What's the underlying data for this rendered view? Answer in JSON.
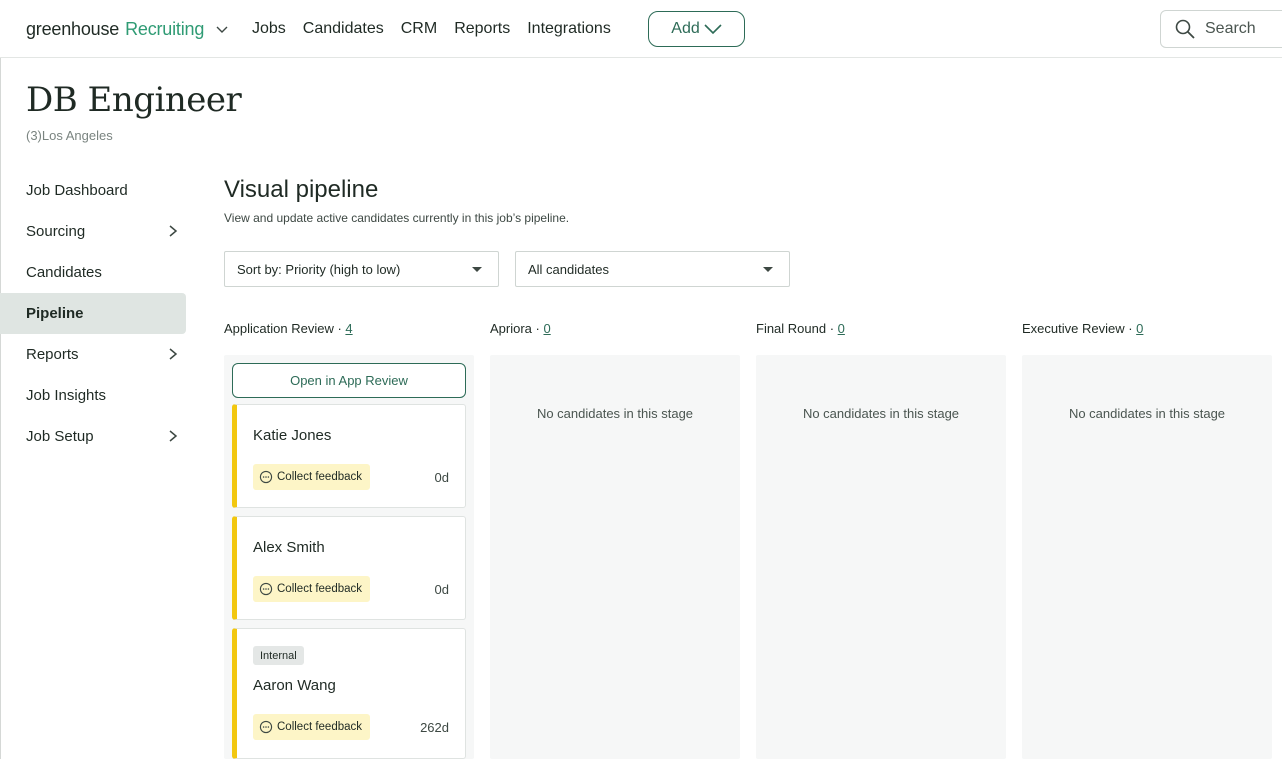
{
  "topnav": {
    "brand": "greenhouse",
    "product": "Recruiting",
    "links": [
      "Jobs",
      "Candidates",
      "CRM",
      "Reports",
      "Integrations"
    ],
    "add_label": "Add",
    "search_placeholder": "Search"
  },
  "job": {
    "title": "DB Engineer",
    "subtitle": "(3)Los Angeles"
  },
  "sidebar": {
    "items": [
      {
        "label": "Job Dashboard",
        "has_chevron": false,
        "active": false
      },
      {
        "label": "Sourcing",
        "has_chevron": true,
        "active": false
      },
      {
        "label": "Candidates",
        "has_chevron": false,
        "active": false
      },
      {
        "label": "Pipeline",
        "has_chevron": false,
        "active": true
      },
      {
        "label": "Reports",
        "has_chevron": true,
        "active": false
      },
      {
        "label": "Job Insights",
        "has_chevron": false,
        "active": false
      },
      {
        "label": "Job Setup",
        "has_chevron": true,
        "active": false
      }
    ]
  },
  "pipeline": {
    "title": "Visual pipeline",
    "description": "View and update active candidates currently in this job’s pipeline.",
    "sort_value": "Sort by: Priority (high to low)",
    "filter_value": "All candidates",
    "open_app_review": "Open in App Review",
    "empty_text": "No candidates in this stage",
    "stages": [
      {
        "name": "Application Review",
        "sep": " · ",
        "count": "4"
      },
      {
        "name": "Apriora",
        "sep": " · ",
        "count": "0"
      },
      {
        "name": "Final Round",
        "sep": " · ",
        "count": "0"
      },
      {
        "name": "Executive Review",
        "sep": " · ",
        "count": "0"
      }
    ],
    "candidates": [
      {
        "name": "Katie Jones",
        "badge": "Collect feedback",
        "days": "0d",
        "tag": ""
      },
      {
        "name": "Alex Smith",
        "badge": "Collect feedback",
        "days": "0d",
        "tag": ""
      },
      {
        "name": "Aaron Wang",
        "badge": "Collect feedback",
        "days": "262d",
        "tag": "Internal"
      }
    ]
  },
  "colors": {
    "accent": "#2d6b57",
    "brand_green": "#2f9b74",
    "card_stripe": "#f2c70f",
    "badge_bg": "#fdf5c7"
  }
}
